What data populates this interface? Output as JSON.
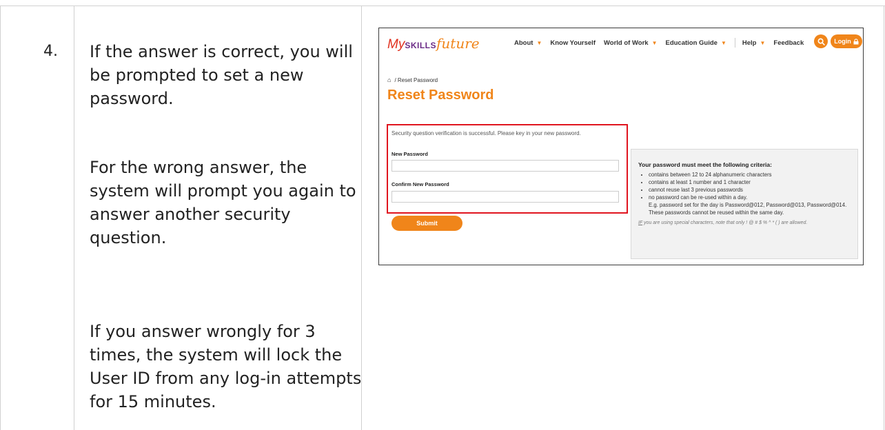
{
  "step": {
    "number": "4.",
    "para1": "If the answer is correct, you will be prompted to set a new password.",
    "para2": "For the wrong answer, the system will prompt you again to answer another security question.",
    "para3": "If you answer wrongly for 3 times, the system will lock the User ID from any log-in attempts for 15 minutes."
  },
  "screenshot": {
    "logo": {
      "my": "My",
      "skills": "SKILLS",
      "future": "future"
    },
    "nav": [
      "About",
      "Know Yourself",
      "World of Work",
      "Education Guide",
      "Help",
      "Feedback"
    ],
    "login_label": "Login",
    "breadcrumb": "/ Reset Password",
    "page_title": "Reset Password",
    "success_message": "Security question verification is successful. Please key in your new password.",
    "new_password_label": "New Password",
    "confirm_password_label": "Confirm New Password",
    "new_password_value": "",
    "confirm_password_value": "",
    "submit_label": "Submit",
    "criteria_heading": "Your password must meet the following criteria:",
    "criteria": [
      "contains between 12 to 24 alphanumeric characters",
      "contains at least 1 number and 1 character",
      "cannot reuse last 3 previous passwords",
      "no password can be re-used within a day."
    ],
    "criteria_example": "E.g. password set for the day is Password@012, Password@013, Password@014. These passwords cannot be reused within the same day.",
    "special_note_if": "IF",
    "special_note_rest": " you are using special characters, note that only ! @ # $ % ^ * ( ) are allowed."
  },
  "colors": {
    "accent_orange": "#f0851a",
    "highlight_red": "#e0141e",
    "logo_purple": "#6b2b86"
  }
}
